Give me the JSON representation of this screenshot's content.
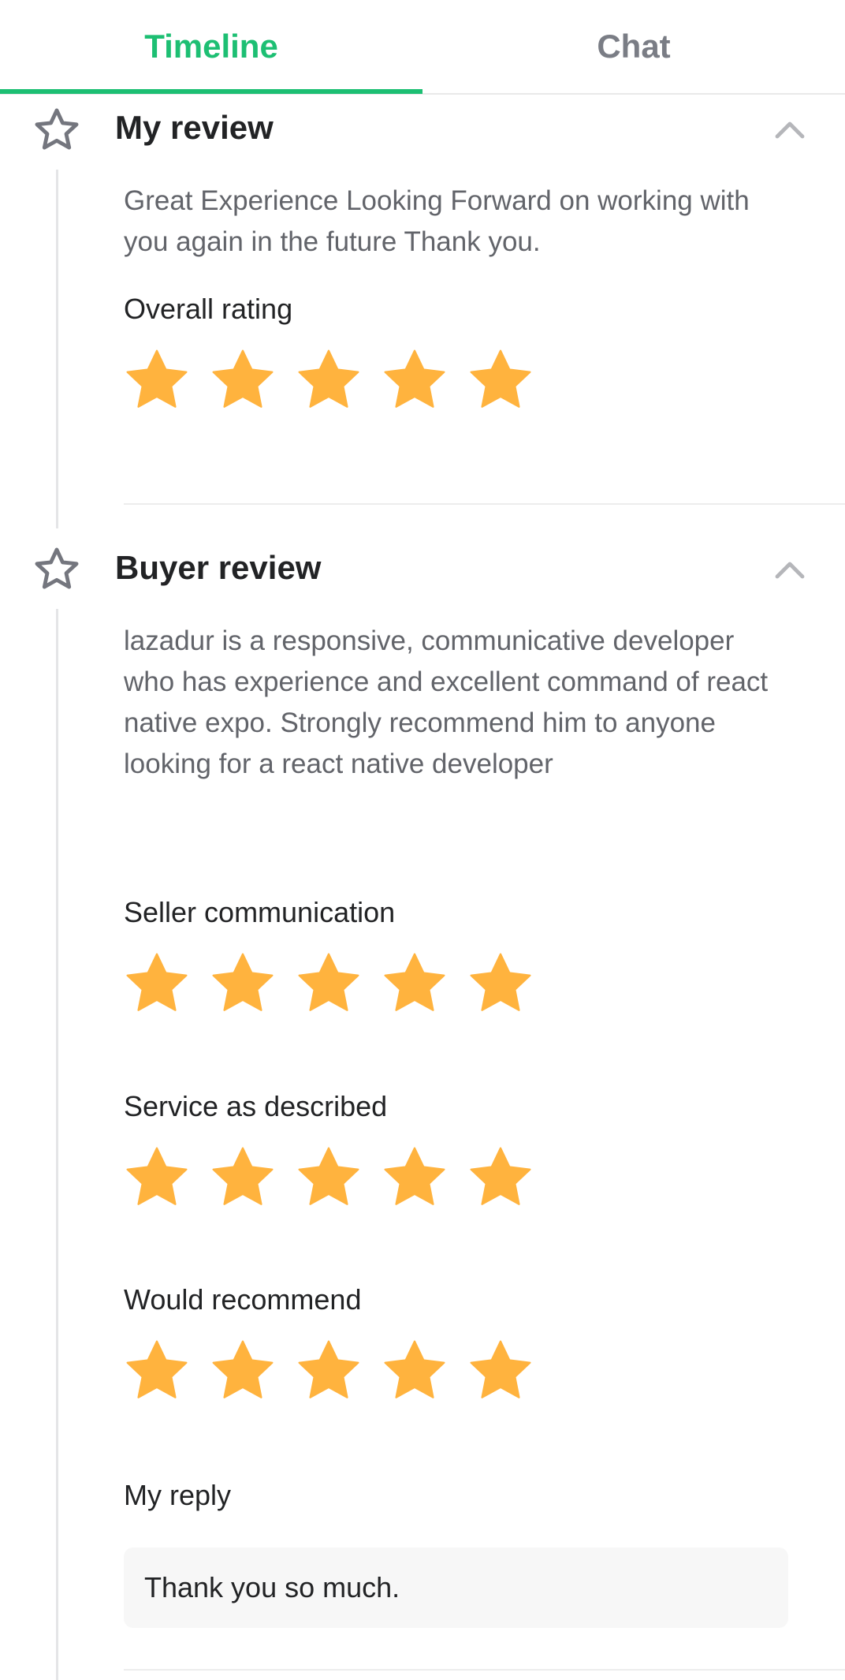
{
  "tabs": [
    {
      "label": "Timeline",
      "active": true
    },
    {
      "label": "Chat",
      "active": false
    }
  ],
  "my_review": {
    "title": "My review",
    "text": "Great Experience Looking Forward on working with you again in the future Thank you.",
    "overall_rating_label": "Overall rating",
    "overall_rating": 5
  },
  "buyer_review": {
    "title": "Buyer review",
    "text": "lazadur is a responsive, communicative developer who has experience and excellent command of react native expo. Strongly recommend him to anyone looking for a react native developer",
    "ratings": [
      {
        "label": "Seller communication",
        "value": 5
      },
      {
        "label": "Service as described",
        "value": 5
      },
      {
        "label": "Would recommend",
        "value": 5
      }
    ],
    "my_reply_label": "My reply",
    "my_reply_text": "Thank you so much."
  },
  "colors": {
    "accent": "#1dbf73",
    "star": "#ffb33e",
    "muted_text": "#62646a",
    "dark_text": "#222325"
  },
  "icons": {
    "timeline_marker": "star-outline-icon",
    "collapse": "chevron-up-icon",
    "rating": "star-filled-icon"
  }
}
